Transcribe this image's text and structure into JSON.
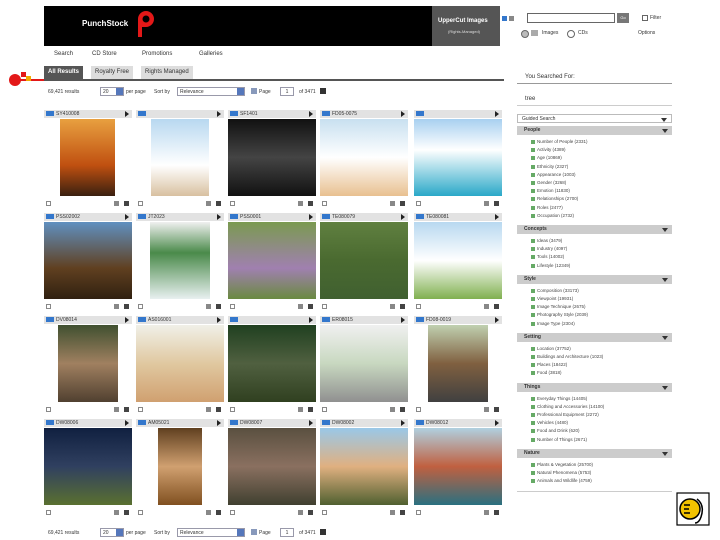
{
  "header": {
    "brand": "PunchStock",
    "partner_name": "UpperCut Images",
    "partner_sub": "(Rights-Managed)",
    "search_value": "",
    "go_label": "Go",
    "filter_label": "Filter",
    "radio_images": "Images",
    "radio_cds": "CDs",
    "options_label": "Options"
  },
  "nav": {
    "search": "Search",
    "cd_store": "CD Store",
    "promotions": "Promotions",
    "galleries": "Galleries"
  },
  "tabs": {
    "all_results": "All Results",
    "royalty_free": "Royalty Free",
    "rights_managed": "Rights Managed"
  },
  "pagination": {
    "results_count": "69,421 results",
    "per_page_value": "20",
    "per_page_label": "per page",
    "sort_label": "Sort by",
    "sort_value": "Relevance",
    "page_label": "Page",
    "page_value": "1",
    "of_pages": "of 3471"
  },
  "grid": [
    {
      "id": "SY410008"
    },
    {
      "id": ""
    },
    {
      "id": "SF1401"
    },
    {
      "id": "FD05-0075"
    },
    {
      "id": ""
    },
    {
      "id": "PSS02002"
    },
    {
      "id": "JT2023"
    },
    {
      "id": "PSS0001"
    },
    {
      "id": "TE080079"
    },
    {
      "id": "TE080081"
    },
    {
      "id": "DV08014"
    },
    {
      "id": "AS016001"
    },
    {
      "id": ""
    },
    {
      "id": "ER08015"
    },
    {
      "id": "FD08-0019"
    },
    {
      "id": "DW08006"
    },
    {
      "id": "AM05021"
    },
    {
      "id": "DW08007"
    },
    {
      "id": "DW08002"
    },
    {
      "id": "DW08012"
    }
  ],
  "sidebar": {
    "you_searched_for": "You Searched For:",
    "search_term": "tree",
    "guided_search": "Guided Search",
    "groups": [
      {
        "name": "People",
        "items": [
          "Number of People (2331)",
          "Activity (4389)",
          "Age (10869)",
          "Ethnicity (2327)",
          "Appearance (1003)",
          "Gender (3268)",
          "Emotion (11830)",
          "Relationships (2700)",
          "Roles (2477)",
          "Occupation (2732)"
        ]
      },
      {
        "name": "Concepts",
        "items": [
          "Ideas (3479)",
          "Industry (4097)",
          "Tools (14002)",
          "Lifestyle (12349)"
        ]
      },
      {
        "name": "Style",
        "items": [
          "Composition (33173)",
          "Viewpoint (19931)",
          "Image Technique (2675)",
          "Photography Style (2039)",
          "Image Type (2304)"
        ]
      },
      {
        "name": "Setting",
        "items": [
          "Location (37752)",
          "Buildings and Architecture (1023)",
          "Places (18422)",
          "Food (3818)"
        ]
      },
      {
        "name": "Things",
        "items": [
          "Everyday Things (14405)",
          "Clothing and Accessories (14100)",
          "Professional Equipment (2272)",
          "Vehicles (4480)",
          "Food and Drink (620)",
          "Number of Things (2671)"
        ]
      },
      {
        "name": "Nature",
        "items": [
          "Plants & Vegetation (25700)",
          "Natural Phenomena (5753)",
          "Animals and Wildlife (4759)"
        ]
      }
    ]
  },
  "colors": {
    "header_bg": "#000000",
    "accent_red": "#e31818",
    "rf_icon": "#3377cc"
  }
}
